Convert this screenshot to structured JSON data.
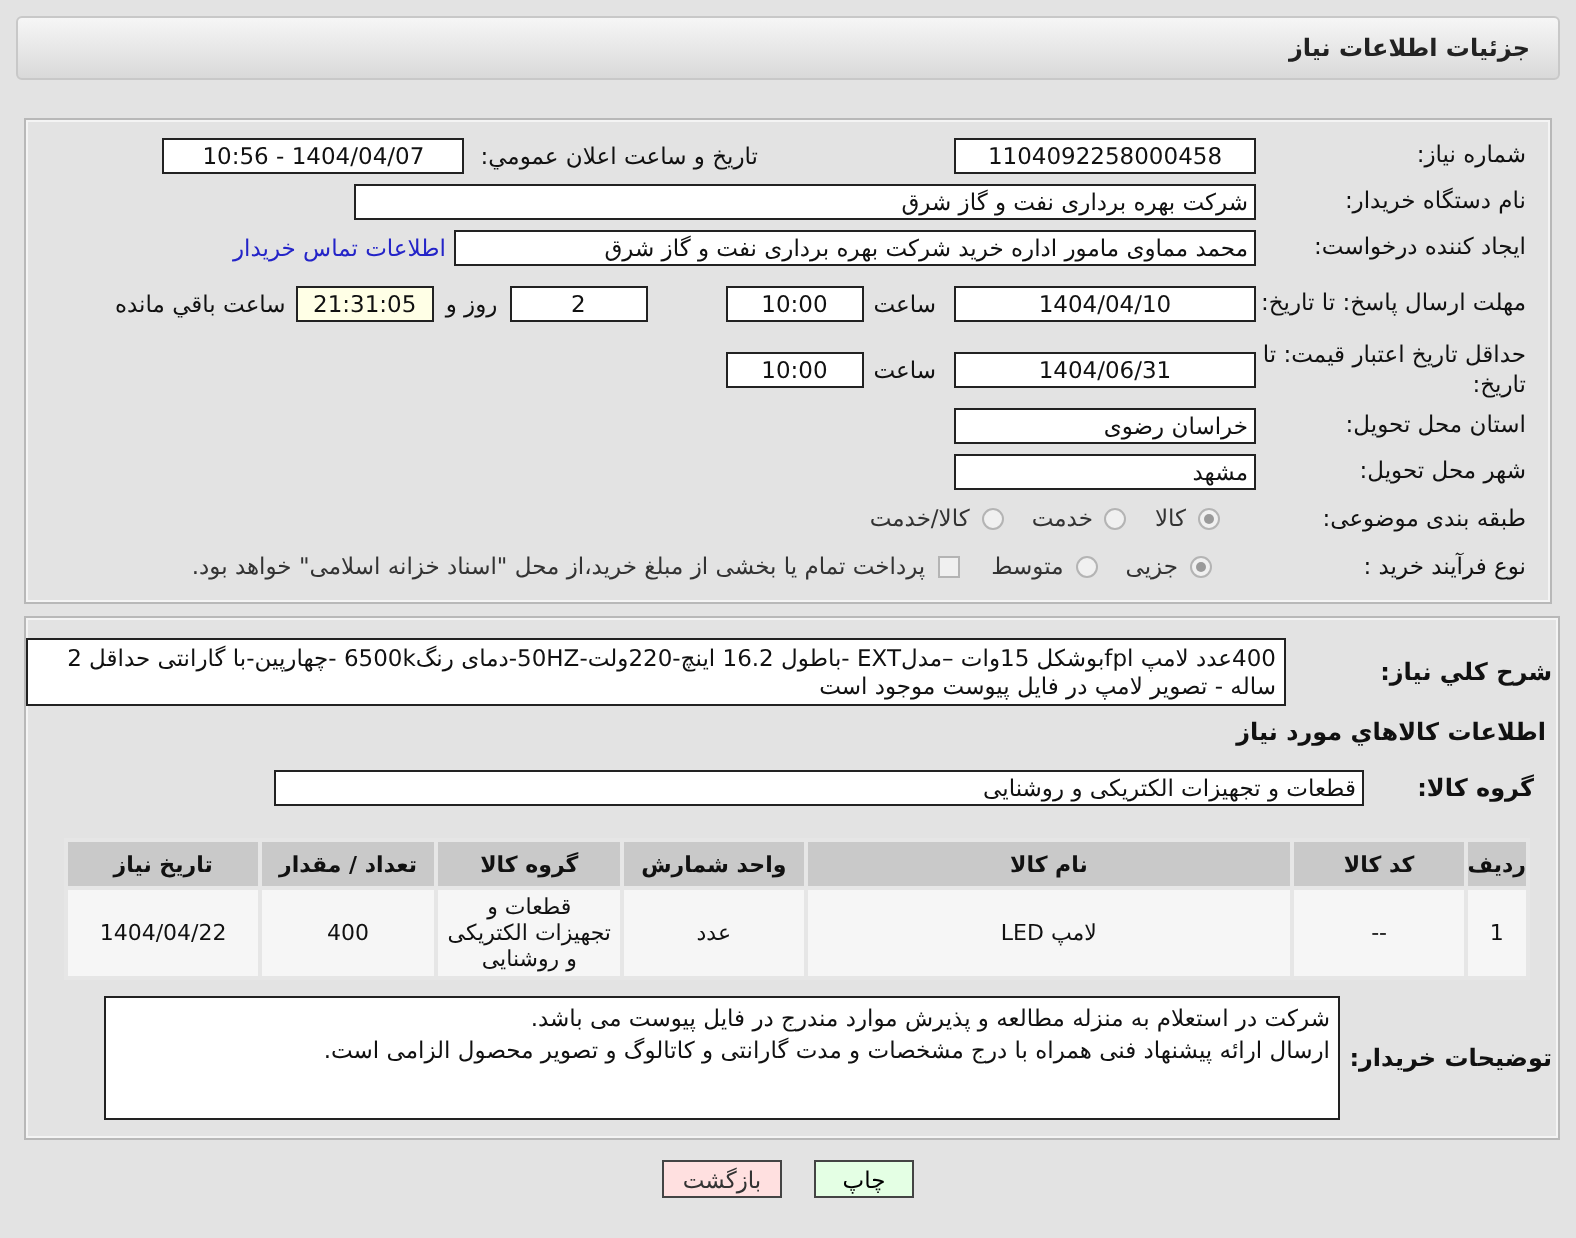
{
  "header": {
    "title": "جزئیات اطلاعات نیاز"
  },
  "form": {
    "need_number": {
      "label": "شماره نیاز:",
      "value": "1104092258000458"
    },
    "announce": {
      "label": "تاریخ و ساعت اعلان عمومي:",
      "value": "1404/04/07 - 10:56"
    },
    "buyer_org": {
      "label": "نام دستگاه خریدار:",
      "value": "شرکت بهره برداری نفت و گاز شرق"
    },
    "requester": {
      "label": "ایجاد کننده درخواست:",
      "value": "محمد مماوی مامور اداره خرید شرکت بهره برداری نفت و گاز شرق",
      "link": "اطلاعات تماس خریدار"
    },
    "response_deadline": {
      "label": "مهلت ارسال پاسخ: تا تاریخ:",
      "date": "1404/04/10",
      "time_label": "ساعت",
      "time": "10:00",
      "days": "2",
      "days_label": "روز و",
      "remaining": "21:31:05",
      "remaining_label": "ساعت باقي مانده"
    },
    "price_validity": {
      "label": "حداقل تاریخ اعتبار قیمت: تا تاریخ:",
      "date": "1404/06/31",
      "time_label": "ساعت",
      "time": "10:00"
    },
    "province": {
      "label": "استان محل تحویل:",
      "value": "خراسان رضوی"
    },
    "city": {
      "label": "شهر محل تحویل:",
      "value": "مشهد"
    },
    "category": {
      "label": "طبقه بندی موضوعی:",
      "options": [
        {
          "label": "کالا",
          "selected": true
        },
        {
          "label": "خدمت",
          "selected": false
        },
        {
          "label": "کالا/خدمت",
          "selected": false
        }
      ]
    },
    "process": {
      "label": "نوع فرآیند خرید :",
      "options": [
        {
          "label": "جزیی",
          "selected": true
        },
        {
          "label": "متوسط",
          "selected": false
        }
      ],
      "payment": {
        "checked": false,
        "text": "پرداخت تمام یا بخشی از مبلغ خرید،از محل \"اسناد خزانه اسلامی\" خواهد بود."
      }
    }
  },
  "details": {
    "description": {
      "label": "شرح کلي نیاز:",
      "value": "400عدد لامپ fplبوشکل 15وات –مدلEXT -باطول 16.2 اینچ-220ولت-50HZ-دمای رنگ6500k -چهارپین-با گارانتی حداقل 2 ساله - تصویر لامپ در فایل پیوست موجود است"
    },
    "goods_title": "اطلاعات کالاهاي مورد نیاز",
    "goods_group": {
      "label": "گروه کالا:",
      "value": "قطعات و تجهیزات الکتریکی و روشنایی"
    },
    "table": {
      "columns": [
        "ردیف",
        "کد کالا",
        "نام کالا",
        "واحد شمارش",
        "گروه کالا",
        "تعداد / مقدار",
        "تاریخ نیاز"
      ],
      "rows": [
        [
          "1",
          "--",
          "لامپ LED",
          "عدد",
          "قطعات و تجهیزات الکتریکی و روشنایی",
          "400",
          "1404/04/22"
        ]
      ]
    },
    "buyer_notes": {
      "label": "توضیحات خریدار:",
      "lines": [
        "شرکت در استعلام به منزله مطالعه و پذیرش موارد مندرج در فایل پیوست می باشد.",
        "ارسال ارائه پیشنهاد فنی همراه با درج مشخصات و مدت گارانتی و کاتالوگ و تصویر محصول الزامی است."
      ]
    }
  },
  "buttons": [
    {
      "label": "چاپ",
      "kind": "print"
    },
    {
      "label": "بازگشت",
      "kind": "back"
    }
  ]
}
